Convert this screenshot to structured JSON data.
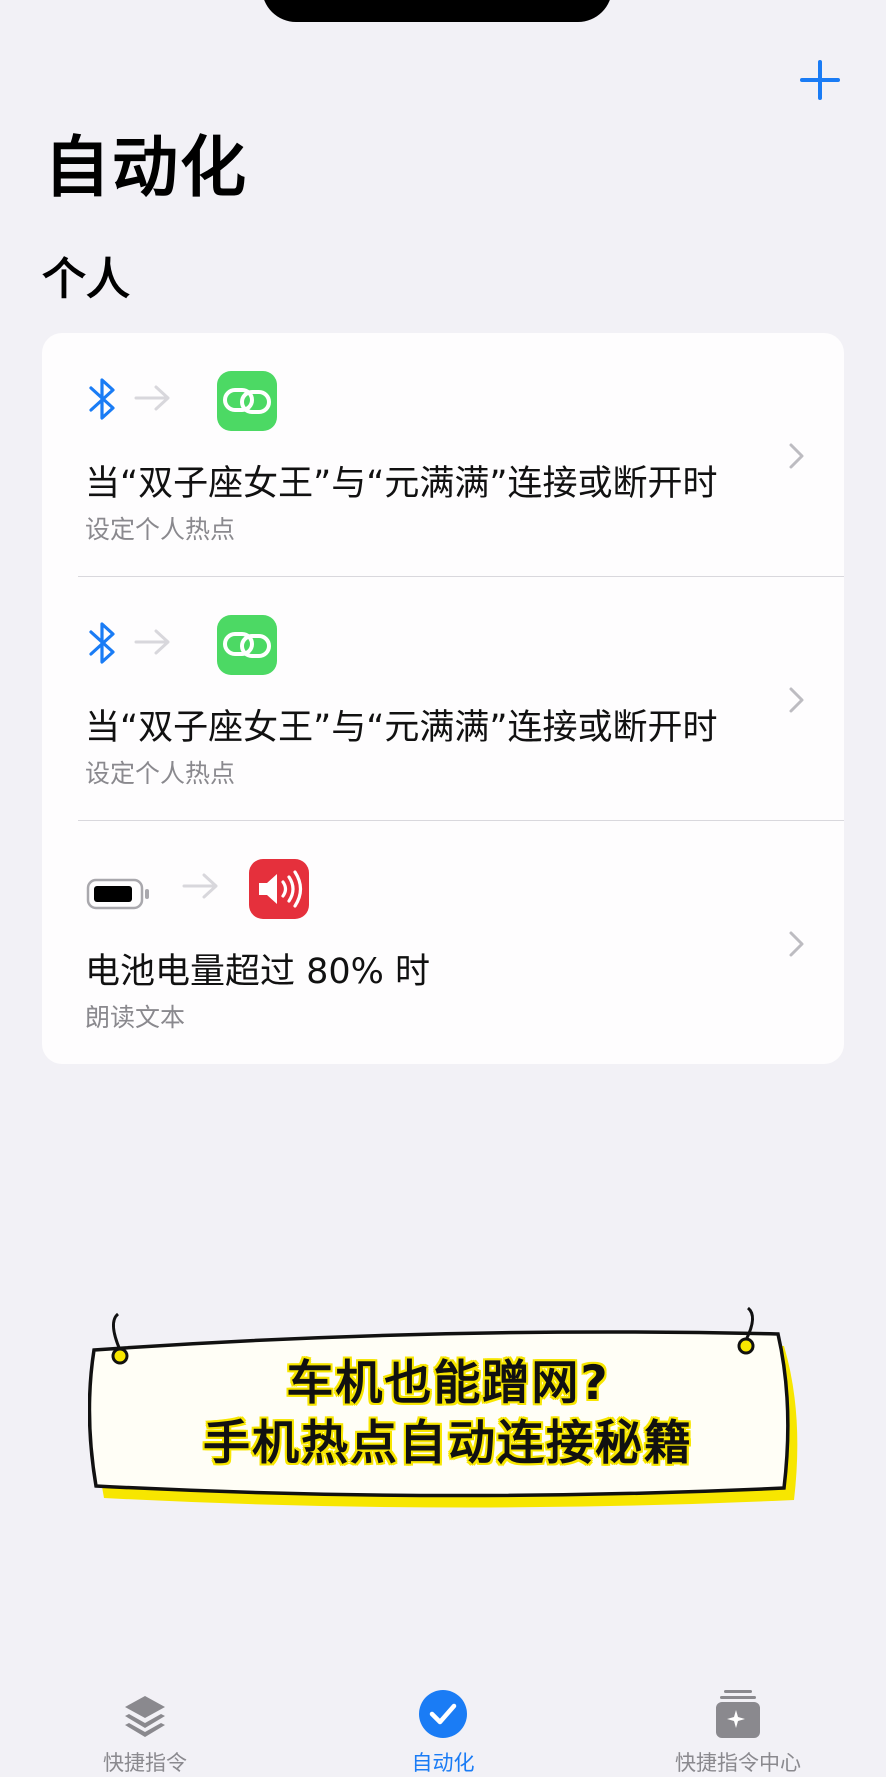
{
  "header": {
    "add_icon": "plus-icon",
    "title": "自动化"
  },
  "section": {
    "title": "个人"
  },
  "automations": [
    {
      "trigger_icon": "bluetooth-icon",
      "action_icon": "link-icon",
      "action_color": "#4cd964",
      "title": "当“双子座女王”与“元满满”连接或断开时",
      "subtitle": "设定个人热点"
    },
    {
      "trigger_icon": "bluetooth-icon",
      "action_icon": "link-icon",
      "action_color": "#4cd964",
      "title": "当“双子座女王”与“元满满”连接或断开时",
      "subtitle": "设定个人热点"
    },
    {
      "trigger_icon": "battery-icon",
      "action_icon": "speaker-icon",
      "action_color": "#e5303c",
      "title": "电池电量超过 80% 时",
      "subtitle": "朗读文本"
    }
  ],
  "banner": {
    "line1": "车机也能蹭网?",
    "line2": "手机热点自动连接秘籍",
    "highlight_color": "#f7e600"
  },
  "tabbar": {
    "tabs": [
      {
        "label": "快捷指令",
        "icon": "stack-icon",
        "active": false
      },
      {
        "label": "自动化",
        "icon": "checkmark-icon",
        "active": true
      },
      {
        "label": "快捷指令中心",
        "icon": "gallery-icon",
        "active": false
      }
    ]
  },
  "colors": {
    "accent": "#1a7cf5",
    "background": "#f2f1f6"
  }
}
